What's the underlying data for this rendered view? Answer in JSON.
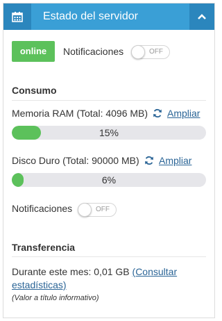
{
  "header": {
    "title": "Estado del servidor",
    "calendar_icon": "calendar-icon",
    "collapse_icon": "chevron-up-icon",
    "color": "#3a9fd6"
  },
  "status": {
    "badge": "online",
    "badge_color": "#5cc15b",
    "notifications_label": "Notificaciones",
    "toggle_text": "OFF",
    "toggle_on": false
  },
  "consumo": {
    "title": "Consumo",
    "ram": {
      "label": "Memoria RAM (Total: 4096 MB)",
      "action": "Ampliar",
      "percent": 15,
      "percent_label": "15%"
    },
    "disk": {
      "label": "Disco Duro (Total: 90000 MB)",
      "action": "Ampliar",
      "percent": 6,
      "percent_label": "6%"
    },
    "notifications_label": "Notificaciones",
    "toggle_text": "OFF",
    "toggle_on": false
  },
  "transferencia": {
    "title": "Transferencia",
    "text": "Durante este mes: 0,01 GB",
    "link": "(Consultar estadísticas)",
    "note": "(Valor a título informativo)"
  }
}
